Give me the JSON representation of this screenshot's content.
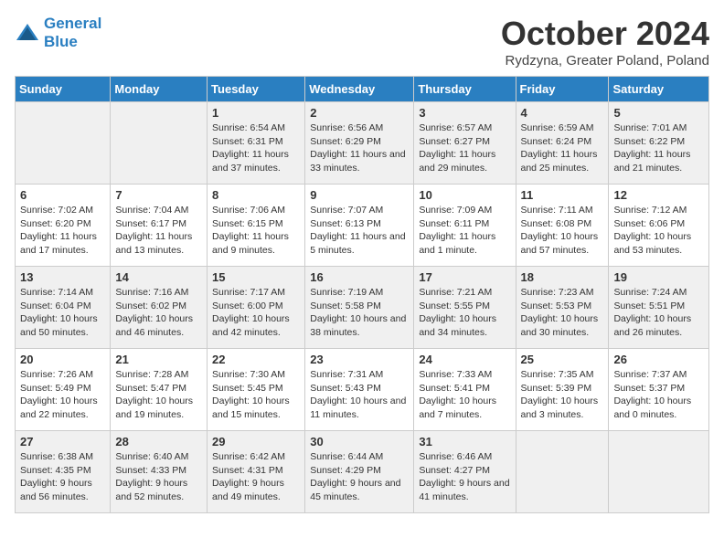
{
  "header": {
    "logo_line1": "General",
    "logo_line2": "Blue",
    "month": "October 2024",
    "location": "Rydzyna, Greater Poland, Poland"
  },
  "weekdays": [
    "Sunday",
    "Monday",
    "Tuesday",
    "Wednesday",
    "Thursday",
    "Friday",
    "Saturday"
  ],
  "weeks": [
    [
      {
        "day": "",
        "info": ""
      },
      {
        "day": "",
        "info": ""
      },
      {
        "day": "1",
        "info": "Sunrise: 6:54 AM\nSunset: 6:31 PM\nDaylight: 11 hours and 37 minutes."
      },
      {
        "day": "2",
        "info": "Sunrise: 6:56 AM\nSunset: 6:29 PM\nDaylight: 11 hours and 33 minutes."
      },
      {
        "day": "3",
        "info": "Sunrise: 6:57 AM\nSunset: 6:27 PM\nDaylight: 11 hours and 29 minutes."
      },
      {
        "day": "4",
        "info": "Sunrise: 6:59 AM\nSunset: 6:24 PM\nDaylight: 11 hours and 25 minutes."
      },
      {
        "day": "5",
        "info": "Sunrise: 7:01 AM\nSunset: 6:22 PM\nDaylight: 11 hours and 21 minutes."
      }
    ],
    [
      {
        "day": "6",
        "info": "Sunrise: 7:02 AM\nSunset: 6:20 PM\nDaylight: 11 hours and 17 minutes."
      },
      {
        "day": "7",
        "info": "Sunrise: 7:04 AM\nSunset: 6:17 PM\nDaylight: 11 hours and 13 minutes."
      },
      {
        "day": "8",
        "info": "Sunrise: 7:06 AM\nSunset: 6:15 PM\nDaylight: 11 hours and 9 minutes."
      },
      {
        "day": "9",
        "info": "Sunrise: 7:07 AM\nSunset: 6:13 PM\nDaylight: 11 hours and 5 minutes."
      },
      {
        "day": "10",
        "info": "Sunrise: 7:09 AM\nSunset: 6:11 PM\nDaylight: 11 hours and 1 minute."
      },
      {
        "day": "11",
        "info": "Sunrise: 7:11 AM\nSunset: 6:08 PM\nDaylight: 10 hours and 57 minutes."
      },
      {
        "day": "12",
        "info": "Sunrise: 7:12 AM\nSunset: 6:06 PM\nDaylight: 10 hours and 53 minutes."
      }
    ],
    [
      {
        "day": "13",
        "info": "Sunrise: 7:14 AM\nSunset: 6:04 PM\nDaylight: 10 hours and 50 minutes."
      },
      {
        "day": "14",
        "info": "Sunrise: 7:16 AM\nSunset: 6:02 PM\nDaylight: 10 hours and 46 minutes."
      },
      {
        "day": "15",
        "info": "Sunrise: 7:17 AM\nSunset: 6:00 PM\nDaylight: 10 hours and 42 minutes."
      },
      {
        "day": "16",
        "info": "Sunrise: 7:19 AM\nSunset: 5:58 PM\nDaylight: 10 hours and 38 minutes."
      },
      {
        "day": "17",
        "info": "Sunrise: 7:21 AM\nSunset: 5:55 PM\nDaylight: 10 hours and 34 minutes."
      },
      {
        "day": "18",
        "info": "Sunrise: 7:23 AM\nSunset: 5:53 PM\nDaylight: 10 hours and 30 minutes."
      },
      {
        "day": "19",
        "info": "Sunrise: 7:24 AM\nSunset: 5:51 PM\nDaylight: 10 hours and 26 minutes."
      }
    ],
    [
      {
        "day": "20",
        "info": "Sunrise: 7:26 AM\nSunset: 5:49 PM\nDaylight: 10 hours and 22 minutes."
      },
      {
        "day": "21",
        "info": "Sunrise: 7:28 AM\nSunset: 5:47 PM\nDaylight: 10 hours and 19 minutes."
      },
      {
        "day": "22",
        "info": "Sunrise: 7:30 AM\nSunset: 5:45 PM\nDaylight: 10 hours and 15 minutes."
      },
      {
        "day": "23",
        "info": "Sunrise: 7:31 AM\nSunset: 5:43 PM\nDaylight: 10 hours and 11 minutes."
      },
      {
        "day": "24",
        "info": "Sunrise: 7:33 AM\nSunset: 5:41 PM\nDaylight: 10 hours and 7 minutes."
      },
      {
        "day": "25",
        "info": "Sunrise: 7:35 AM\nSunset: 5:39 PM\nDaylight: 10 hours and 3 minutes."
      },
      {
        "day": "26",
        "info": "Sunrise: 7:37 AM\nSunset: 5:37 PM\nDaylight: 10 hours and 0 minutes."
      }
    ],
    [
      {
        "day": "27",
        "info": "Sunrise: 6:38 AM\nSunset: 4:35 PM\nDaylight: 9 hours and 56 minutes."
      },
      {
        "day": "28",
        "info": "Sunrise: 6:40 AM\nSunset: 4:33 PM\nDaylight: 9 hours and 52 minutes."
      },
      {
        "day": "29",
        "info": "Sunrise: 6:42 AM\nSunset: 4:31 PM\nDaylight: 9 hours and 49 minutes."
      },
      {
        "day": "30",
        "info": "Sunrise: 6:44 AM\nSunset: 4:29 PM\nDaylight: 9 hours and 45 minutes."
      },
      {
        "day": "31",
        "info": "Sunrise: 6:46 AM\nSunset: 4:27 PM\nDaylight: 9 hours and 41 minutes."
      },
      {
        "day": "",
        "info": ""
      },
      {
        "day": "",
        "info": ""
      }
    ]
  ]
}
